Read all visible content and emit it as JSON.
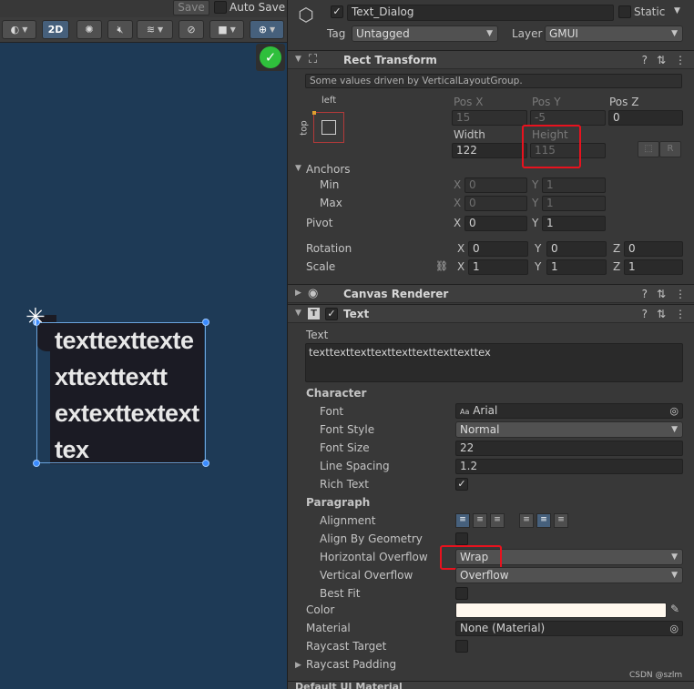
{
  "scene": {
    "toolbar": {
      "save_label": "Save",
      "auto_save_label": "Auto Save",
      "mode_2d_label": "2D"
    },
    "text_preview": "texttexttexte\nxttexttextt\nextexttextext\ntex"
  },
  "inspector": {
    "object_name": "Text_Dialog",
    "static_label": "Static",
    "tag_label": "Tag",
    "tag_value": "Untagged",
    "layer_label": "Layer",
    "layer_value": "GMUI",
    "rect_transform": {
      "title": "Rect Transform",
      "driven_note": "Some values driven by VerticalLayoutGroup.",
      "anchor_preset_left": "left",
      "anchor_preset_top": "top",
      "pos_x_label": "Pos X",
      "pos_y_label": "Pos Y",
      "pos_z_label": "Pos Z",
      "pos_x": "15",
      "pos_y": "-5",
      "pos_z": "0",
      "width_label": "Width",
      "height_label": "Height",
      "width": "122",
      "height": "115",
      "r_button": "R",
      "anchors_label": "Anchors",
      "min_label": "Min",
      "max_label": "Max",
      "min_x": "0",
      "min_y": "1",
      "max_x": "0",
      "max_y": "1",
      "pivot_label": "Pivot",
      "pivot_x": "0",
      "pivot_y": "1",
      "rotation_label": "Rotation",
      "rot_x": "0",
      "rot_y": "0",
      "rot_z": "0",
      "scale_label": "Scale",
      "scale_x": "1",
      "scale_y": "1",
      "scale_z": "1",
      "axis_x": "X",
      "axis_y": "Y",
      "axis_z": "Z"
    },
    "canvas_renderer": {
      "title": "Canvas Renderer"
    },
    "text_component": {
      "title": "Text",
      "text_label": "Text",
      "text_value": "texttexttexttexttexttexttexttexttex",
      "character_label": "Character",
      "font_label": "Font",
      "font_value": "Arial",
      "font_style_label": "Font Style",
      "font_style_value": "Normal",
      "font_size_label": "Font Size",
      "font_size_value": "22",
      "line_spacing_label": "Line Spacing",
      "line_spacing_value": "1.2",
      "rich_text_label": "Rich Text",
      "paragraph_label": "Paragraph",
      "alignment_label": "Alignment",
      "align_by_geometry_label": "Align By Geometry",
      "horizontal_overflow_label": "Horizontal Overflow",
      "horizontal_overflow_value": "Wrap",
      "vertical_overflow_label": "Vertical Overflow",
      "vertical_overflow_value": "Overflow",
      "best_fit_label": "Best Fit",
      "color_label": "Color",
      "color_value": "#fff8ee",
      "material_label": "Material",
      "material_value": "None (Material)",
      "raycast_target_label": "Raycast Target",
      "raycast_padding_label": "Raycast Padding",
      "next_component_label": "Default UI Material"
    },
    "watermark": "CSDN @szlm"
  }
}
